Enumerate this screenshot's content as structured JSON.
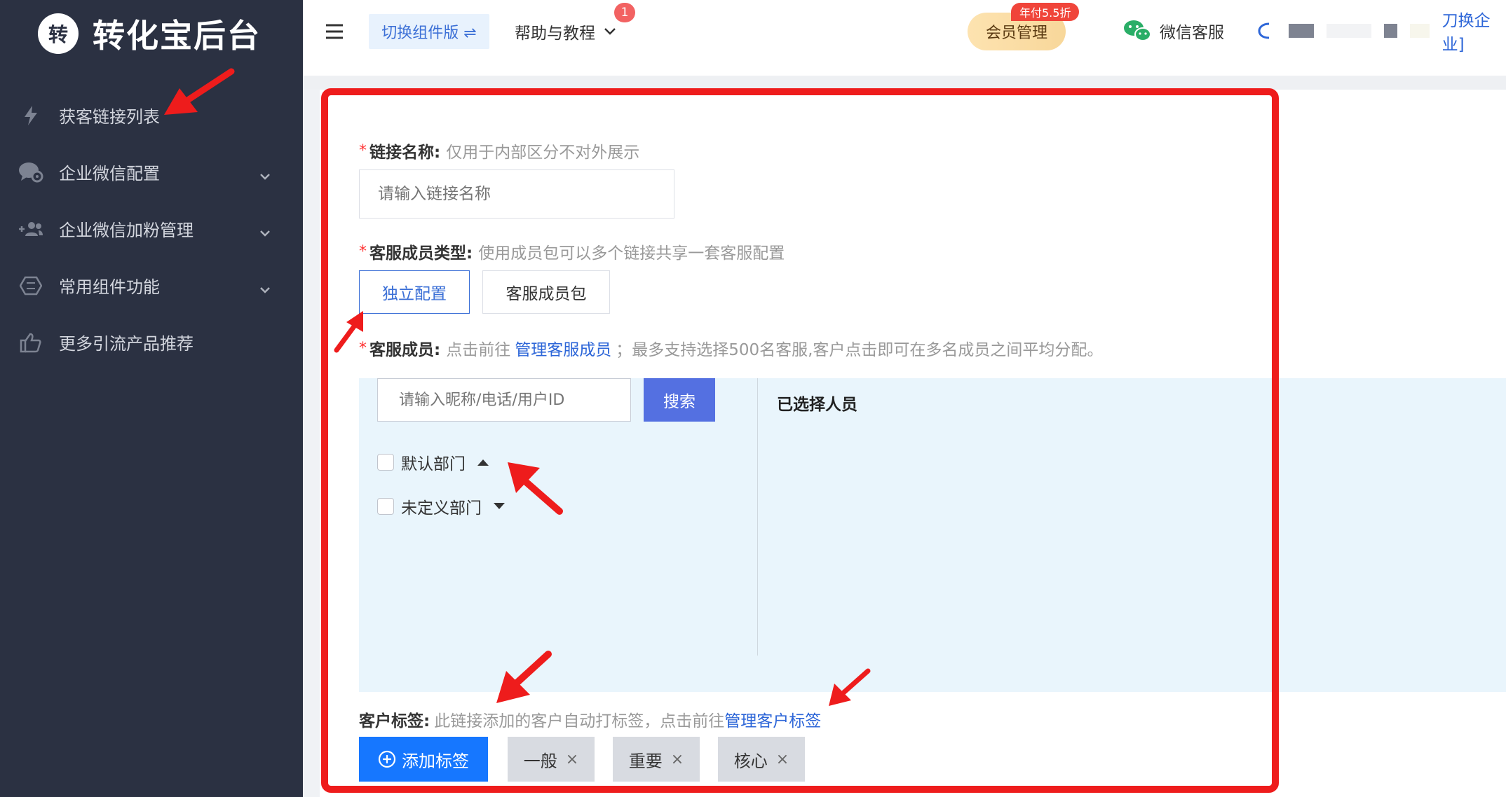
{
  "brand": {
    "logo_char": "转",
    "title": "转化宝后台"
  },
  "sidebar": {
    "items": [
      {
        "label": "获客链接列表",
        "icon": "lightning-icon",
        "has_chevron": false
      },
      {
        "label": "企业微信配置",
        "icon": "chat-settings-icon",
        "has_chevron": true
      },
      {
        "label": "企业微信加粉管理",
        "icon": "add-users-icon",
        "has_chevron": true
      },
      {
        "label": "常用组件功能",
        "icon": "hexagon-icon",
        "has_chevron": true
      },
      {
        "label": "更多引流产品推荐",
        "icon": "thumbs-up-icon",
        "has_chevron": false
      }
    ]
  },
  "topbar": {
    "switch_label": "切换组件版 ⇌",
    "help_label": "帮助与教程",
    "help_badge": "1",
    "member_label": "会员管理",
    "member_badge": "年付5.5折",
    "wechat_service_label": "微信客服",
    "enterprise_label": "刀换企业]"
  },
  "form": {
    "link_name": {
      "label": "链接名称:",
      "hint": "仅用于内部区分不对外展示",
      "placeholder": "请输入链接名称"
    },
    "member_type": {
      "label": "客服成员类型:",
      "hint": "使用成员包可以多个链接共享一套客服配置",
      "options": [
        "独立配置",
        "客服成员包"
      ],
      "selected": "独立配置"
    },
    "members": {
      "label": "客服成员:",
      "hint_before": "点击前往",
      "link": "管理客服成员",
      "hint_after": "；最多支持选择500名客服,客户点击即可在多名成员之间平均分配。",
      "search_placeholder": "请输入昵称/电话/用户ID",
      "search_button": "搜索",
      "selected_title": "已选择人员",
      "departments": [
        {
          "name": "默认部门",
          "expanded": true
        },
        {
          "name": "未定义部门",
          "expanded": false
        }
      ]
    },
    "tags": {
      "label": "客户标签:",
      "hint": "此链接添加的客户自动打标签，点击前往",
      "link": "管理客户标签",
      "add_button": "添加标签",
      "chips": [
        "一般",
        "重要",
        "核心"
      ],
      "close_glyph": "×"
    }
  },
  "colors": {
    "sidebar_bg": "#2b3142",
    "accent": "#3b6fd6",
    "annotation_red": "#ee1c1c",
    "tag_button": "#1677ff"
  }
}
